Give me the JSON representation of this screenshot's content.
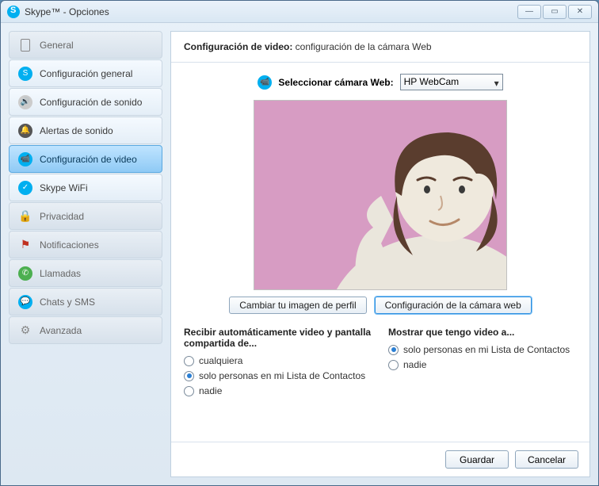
{
  "window": {
    "title": "Skype™ - Opciones"
  },
  "sidebar": {
    "items": [
      {
        "label": "General",
        "cat": true
      },
      {
        "label": "Configuración general"
      },
      {
        "label": "Configuración de sonido"
      },
      {
        "label": "Alertas de sonido"
      },
      {
        "label": "Configuración de video",
        "selected": true
      },
      {
        "label": "Skype WiFi"
      },
      {
        "label": "Privacidad",
        "cat": true
      },
      {
        "label": "Notificaciones",
        "cat": true
      },
      {
        "label": "Llamadas",
        "cat": true
      },
      {
        "label": "Chats y SMS",
        "cat": true
      },
      {
        "label": "Avanzada",
        "cat": true
      }
    ]
  },
  "panel": {
    "header_bold": "Configuración de video:",
    "header_rest": " configuración de la cámara Web",
    "select_label": "Seleccionar cámara Web:",
    "selected_camera": "HP WebCam",
    "btn_change_profile": "Cambiar tu imagen de perfil",
    "btn_cam_settings": "Configuración de la cámara web",
    "group1_title": "Recibir automáticamente video y pantalla compartida de...",
    "group1": {
      "opt1": "cualquiera",
      "opt2": "solo personas en mi Lista de Contactos",
      "opt3": "nadie",
      "selected": "opt2"
    },
    "group2_title": "Mostrar que tengo video a...",
    "group2": {
      "opt1": "solo personas en mi Lista de Contactos",
      "opt2": "nadie",
      "selected": "opt1"
    }
  },
  "footer": {
    "save": "Guardar",
    "cancel": "Cancelar"
  }
}
